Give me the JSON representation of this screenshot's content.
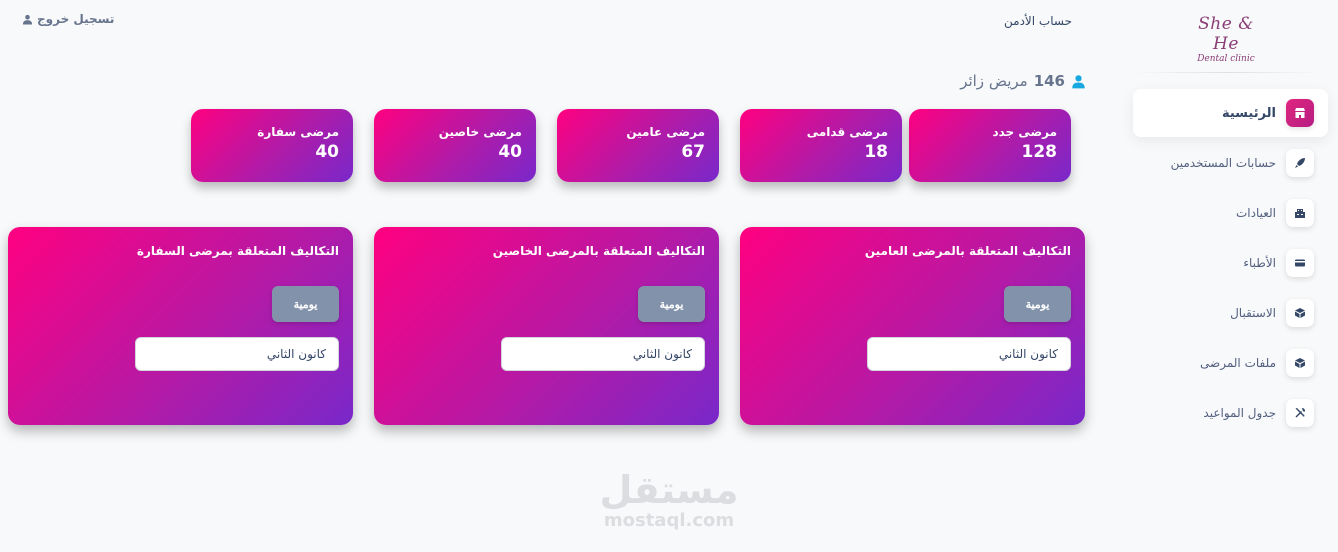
{
  "brand": {
    "logo_main": "She & He",
    "logo_sub": "Dental clinic"
  },
  "header": {
    "admin_label": "حساب الأدمن",
    "logout_label": "تسجيل خروج"
  },
  "visitors": {
    "count": "146",
    "label": "مريض زائر"
  },
  "sidebar": {
    "items": [
      {
        "label": "الرئيسية",
        "icon": "shop-icon",
        "active": true
      },
      {
        "label": "حسابات المستخدمين",
        "icon": "rocket-icon"
      },
      {
        "label": "العيادات",
        "icon": "building-icon"
      },
      {
        "label": "الأطباء",
        "icon": "credit-card-icon"
      },
      {
        "label": "الاستقبال",
        "icon": "box-icon"
      },
      {
        "label": "ملفات المرضى",
        "icon": "box-icon"
      },
      {
        "label": "جدول المواعيد",
        "icon": "tools-icon"
      }
    ]
  },
  "stats": [
    {
      "label": "مرضى جدد",
      "value": "128"
    },
    {
      "label": "مرضى قدامى",
      "value": "18"
    },
    {
      "label": "مرضى عامين",
      "value": "67"
    },
    {
      "label": "مرضى خاصين",
      "value": "40"
    },
    {
      "label": "مرضى سفارة",
      "value": "40"
    }
  ],
  "cost_cards": [
    {
      "title": "التكاليف المتعلقة بالمرضى العامين",
      "button": "يومية",
      "month": "كانون الثاني"
    },
    {
      "title": "التكاليف المتعلقة بالمرضى الخاصين",
      "button": "يومية",
      "month": "كانون الثاني"
    },
    {
      "title": "التكاليف المتعلقة بمرضى السفارة",
      "button": "يومية",
      "month": "كانون الثاني"
    }
  ],
  "watermark": {
    "arabic": "مستقل",
    "latin": "mostaql.com"
  },
  "colors": {
    "accent_start": "#ff0080",
    "accent_end": "#7928ca",
    "button_gray": "#8392ab",
    "background": "#f8f9fa"
  }
}
